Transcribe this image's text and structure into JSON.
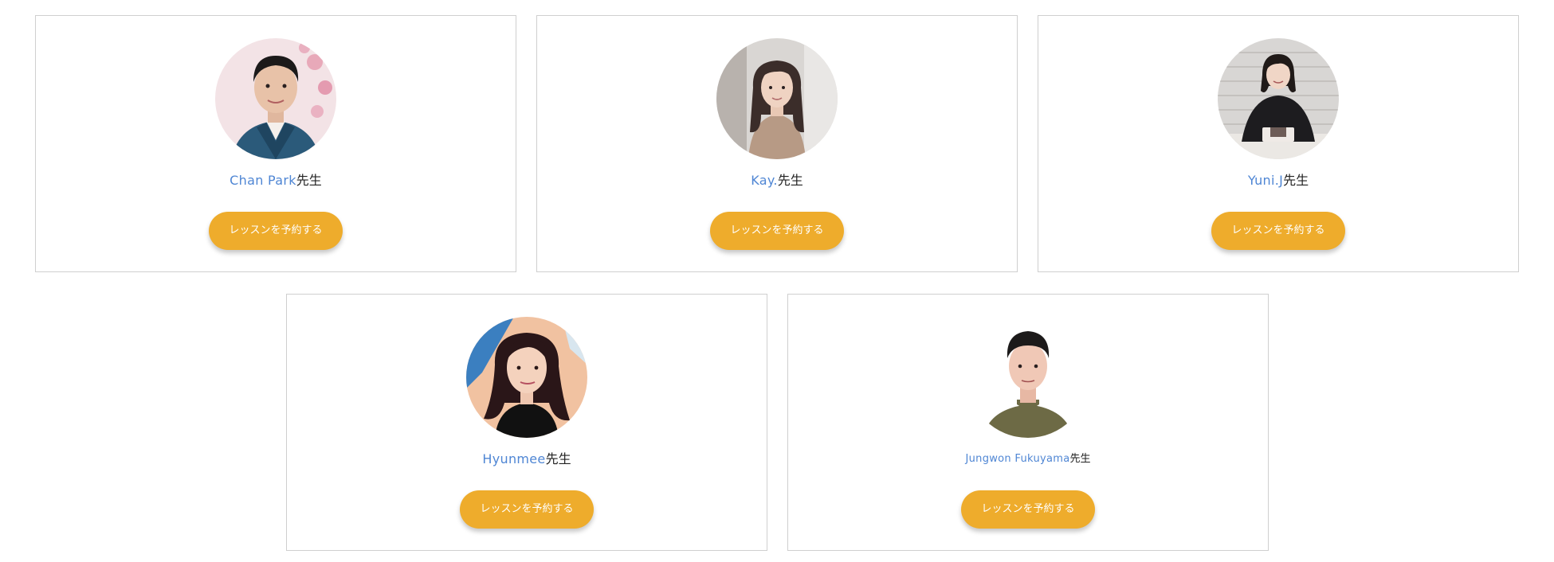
{
  "teachers": [
    {
      "name": "Chan Park",
      "honorific": "先生",
      "button_label": "レッスンを予約する",
      "avatar_icon": "teacher-photo"
    },
    {
      "name": "Kay.",
      "honorific": "先生",
      "button_label": "レッスンを予約する",
      "avatar_icon": "teacher-photo"
    },
    {
      "name": "Yuni.J",
      "honorific": "先生",
      "button_label": "レッスンを予約する",
      "avatar_icon": "teacher-photo"
    },
    {
      "name": "Hyunmee",
      "honorific": "先生",
      "button_label": "レッスンを予約する",
      "avatar_icon": "teacher-photo"
    },
    {
      "name": "Jungwon Fukuyama",
      "honorific": "先生",
      "button_label": "レッスンを予約する",
      "avatar_icon": "teacher-photo"
    }
  ],
  "colors": {
    "name_link": "#4f86d4",
    "button_bg": "#eeac2c",
    "button_text": "#ffffff",
    "card_border": "#cfcfcf"
  }
}
